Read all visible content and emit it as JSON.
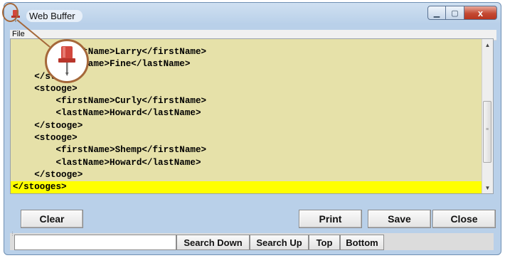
{
  "window": {
    "title": "Web Buffer",
    "controls": {
      "minimize_icon": "minimize-icon",
      "maximize_icon": "maximize-icon",
      "close_glyph": "x"
    }
  },
  "menu": {
    "file_label": "File"
  },
  "editor": {
    "lines": [
      "        <firstName>Larry</firstName>",
      "        <lastName>Fine</lastName>",
      "    </stooge>",
      "    <stooge>",
      "        <firstName>Curly</firstName>",
      "        <lastName>Howard</lastName>",
      "    </stooge>",
      "    <stooge>",
      "        <firstName>Shemp</firstName>",
      "        <lastName>Howard</lastName>",
      "    </stooge>",
      "</stooges>"
    ],
    "highlighted_line_index": 11,
    "highlight_color": "#ffff00",
    "background_color": "#e6e1a9"
  },
  "buttons": {
    "clear": "Clear",
    "print": "Print",
    "save": "Save",
    "close": "Close"
  },
  "search": {
    "input_value": "",
    "search_down": "Search Down",
    "search_up": "Search Up",
    "top": "Top",
    "bottom": "Bottom"
  },
  "accent_color": "#a5683a",
  "icons": [
    "pushpin-icon"
  ]
}
